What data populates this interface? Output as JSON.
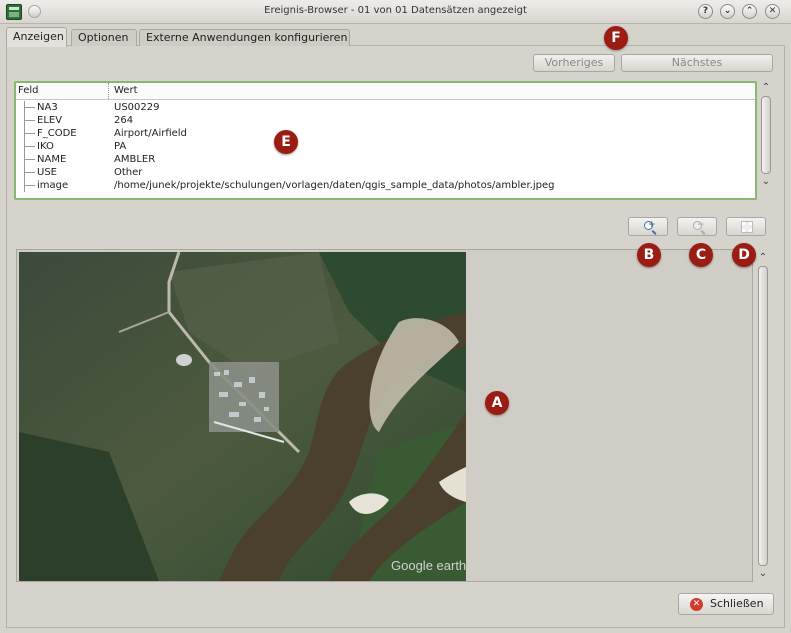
{
  "window": {
    "title": "Ereignis-Browser - 01 von 01 Datensätzen angezeigt",
    "buttons": [
      "?",
      "⌄",
      "⌃",
      "✕"
    ]
  },
  "tabs": [
    {
      "label": "Anzeigen",
      "active": true
    },
    {
      "label": "Optionen",
      "active": false
    },
    {
      "label": "Externe Anwendungen konfigurieren",
      "active": false
    }
  ],
  "nav": {
    "previous_label": "Vorheriges",
    "next_label": "Nächstes",
    "enabled": false
  },
  "attributes": {
    "header_field": "Feld",
    "header_value": "Wert",
    "rows": [
      {
        "field": "NA3",
        "value": "US00229"
      },
      {
        "field": "ELEV",
        "value": "264"
      },
      {
        "field": "F_CODE",
        "value": "Airport/Airfield"
      },
      {
        "field": "IKO",
        "value": "PA"
      },
      {
        "field": "NAME",
        "value": "AMBLER"
      },
      {
        "field": "USE",
        "value": "Other"
      },
      {
        "field": "image",
        "value": "/home/junek/projekte/schulungen/vorlagen/daten/qgis_sample_data/photos/ambler.jpeg"
      }
    ]
  },
  "zoom": {
    "zoom_in_icon": "zoom-in-icon",
    "zoom_out_icon": "zoom-out-icon",
    "fit_icon": "zoom-fit-icon"
  },
  "photo": {
    "watermark": "Google earth"
  },
  "markers": {
    "a": "A",
    "b": "B",
    "c": "C",
    "d": "D",
    "e": "E",
    "f": "F"
  },
  "close_label": "Schließen",
  "colors": {
    "marker": "#9b1c12",
    "attr_border": "#86b86e"
  }
}
